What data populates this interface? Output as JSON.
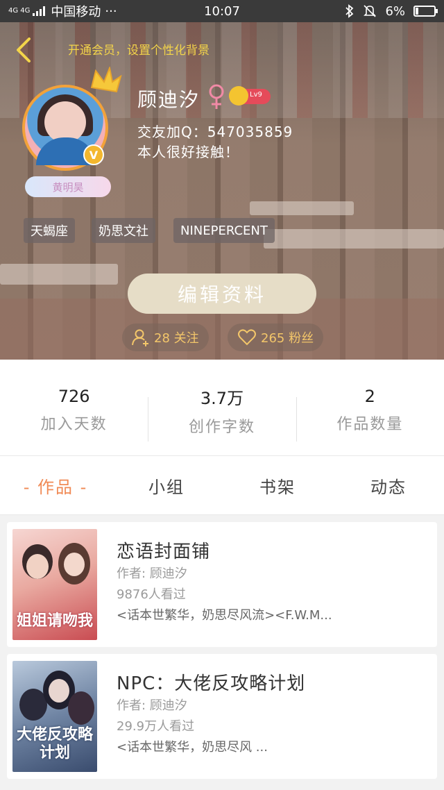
{
  "status_bar": {
    "network": "4G 4G",
    "carrier": "中国移动",
    "dots": "···",
    "time": "10:07",
    "battery": "6%"
  },
  "header": {
    "vip_link": "开通会员，设置个性化背景",
    "username": "顾迪汐",
    "level": "Lv9",
    "qq": "交友加Q：547035859",
    "intro": "本人很好接触！",
    "title_badge": "黄明昊",
    "tags": [
      "天蝎座",
      "奶思文社",
      "NINEPERCENT"
    ],
    "edit_button": "编辑资料",
    "following": "28 关注",
    "fans": "265 粉丝",
    "colors": {
      "accent": "#f08a55",
      "gold": "#f3d44a"
    }
  },
  "stats": [
    {
      "value": "726",
      "label": "加入天数"
    },
    {
      "value": "3.7万",
      "label": "创作字数"
    },
    {
      "value": "2",
      "label": "作品数量"
    }
  ],
  "tabs": [
    {
      "label": "- 作品 -",
      "active": true
    },
    {
      "label": "小组",
      "active": false
    },
    {
      "label": "书架",
      "active": false
    },
    {
      "label": "动态",
      "active": false
    }
  ],
  "books": [
    {
      "title": "恋语封面铺",
      "author": "作者: 顾迪汐",
      "views": "9876人看过",
      "tags": "<话本世繁华，奶思尽风流><F.W.M...",
      "cover_text": "姐姐请吻我"
    },
    {
      "title": "NPC：大佬反攻略计划",
      "author": "作者: 顾迪汐",
      "views": "29.9万人看过",
      "tags": "<话本世繁华，奶思尽风 ...",
      "cover_text": "大佬反攻略计划"
    }
  ]
}
